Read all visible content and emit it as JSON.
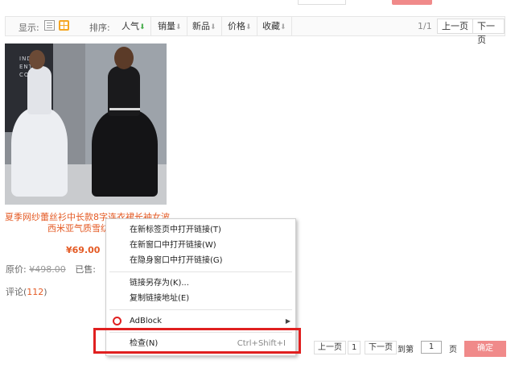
{
  "toolbar": {
    "display_label": "显示:",
    "sort_label": "排序:",
    "sort_options": [
      "人气",
      "销量",
      "新品",
      "价格",
      "收藏"
    ],
    "page_count": "1/1",
    "prev_label": "上一页",
    "next_label": "下一页"
  },
  "product": {
    "image_text_lines": [
      "INDE",
      "ENT",
      "COM"
    ],
    "title": "夏季网纱蕾丝衫中长款8字连衣裙长袖女波西米亚气质雪纺沙滩",
    "price": "¥69.00",
    "orig_label": "原价:",
    "orig_price": "¥498.00",
    "sold_label": "已售:",
    "comments_label": "评论",
    "comments_count": "112"
  },
  "context_menu": {
    "items": [
      {
        "label": "在新标签页中打开链接(T)"
      },
      {
        "label": "在新窗口中打开链接(W)"
      },
      {
        "label": "在隐身窗口中打开链接(G)"
      },
      {
        "label": "链接另存为(K)..."
      },
      {
        "label": "复制链接地址(E)"
      },
      {
        "label": "AdBlock",
        "icon": "opera-icon"
      },
      {
        "label": "检查(N)",
        "shortcut": "Ctrl+Shift+I"
      }
    ]
  },
  "bottom_pager": {
    "prev_label": "上一页",
    "current_page": "1",
    "next_label": "下一页",
    "goto_label": "到第",
    "page_input": "1",
    "page_unit": "页",
    "confirm_label": "确定"
  },
  "colors": {
    "accent": "#e45a24",
    "button": "#f08a8a",
    "highlight": "#e02020"
  }
}
